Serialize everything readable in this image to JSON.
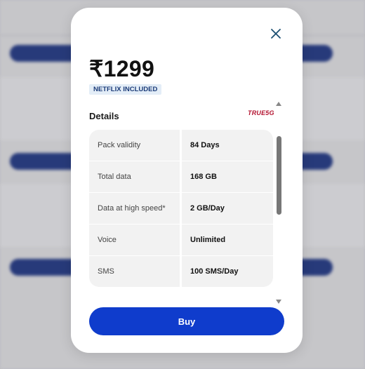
{
  "modal": {
    "price": "₹1299",
    "badge": "NETFLIX INCLUDED",
    "details_title": "Details",
    "logo_text": "TRUE5G",
    "buy_label": "Buy",
    "rows": [
      {
        "label": "Pack validity",
        "value": "84 Days"
      },
      {
        "label": "Total data",
        "value": "168 GB"
      },
      {
        "label": "Data at high speed*",
        "value": "2 GB/Day"
      },
      {
        "label": "Voice",
        "value": "Unlimited"
      },
      {
        "label": "SMS",
        "value": "100 SMS/Day"
      }
    ]
  },
  "colors": {
    "accent": "#0f3ccc",
    "badge_bg": "#e3edf7",
    "logo_red": "#b3122f",
    "close_icon": "#1b4f72"
  },
  "icons": [
    "close-icon",
    "scroll-up-icon",
    "scroll-down-icon"
  ]
}
